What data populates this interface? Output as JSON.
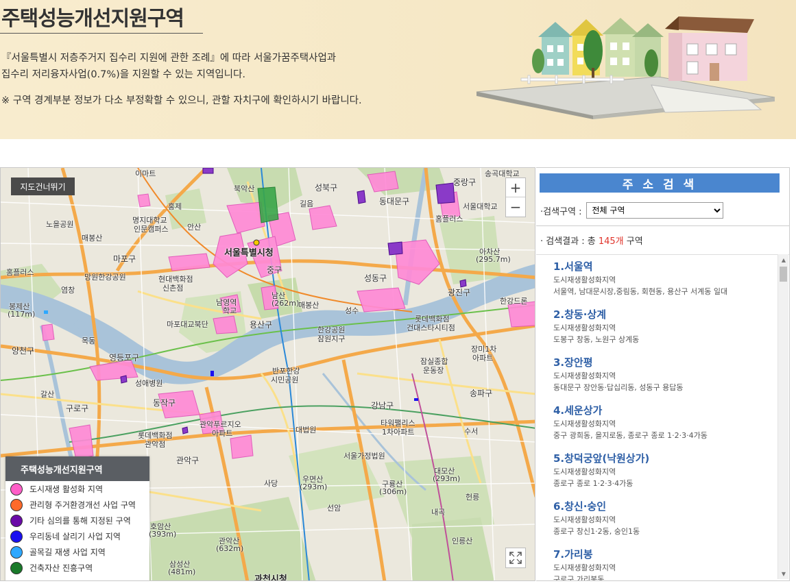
{
  "banner": {
    "title": "주택성능개선지원구역",
    "desc_line1": "『서울특별시 저층주거지 집수리 지원에 관한 조례』에 따라 서울가꿈주택사업과",
    "desc_line2": "집수리 저리융자사업(0.7%)을 지원할 수 있는 지역입니다.",
    "note": "※ 구역 경계부분 정보가 다소 부정확할 수 있으니, 관할 자치구에 확인하시기 바랍니다."
  },
  "map": {
    "skip_label": "지도건너뛰기",
    "zoom_in": "+",
    "zoom_out": "−",
    "labels": {
      "city_hall": "서울특별시청",
      "jung_gu": "중구",
      "yongsan_gu": "용산구",
      "seongdong_gu": "성동구",
      "gwangjin_gu": "광진구",
      "gangnam_gu": "강남구",
      "mapo_gu": "마포구",
      "yeongdeungpo_gu": "영등포구",
      "yangcheon_gu": "양천구",
      "guro_gu": "구로구",
      "dongjak_gu": "동작구",
      "gwanak_gu": "관악구",
      "songpa_gu": "송파구",
      "dongdaemun_gu": "동대문구",
      "seongbuk_gu": "성북구",
      "jungnang_gu": "중랑구",
      "namsan": "남산",
      "namsan_alt": "(262m)",
      "bongjesan": "봉제산",
      "bongjesan_alt": "(117m)",
      "achasan": "아차산",
      "achasan_alt": "(295.7m)",
      "umyeonsan": "우면산",
      "umyeonsan_alt": "(293m)",
      "gwanaksan": "관악산",
      "gwanaksan_alt": "(632m)",
      "samseongsan": "삼성산",
      "samseongsan_alt": "(481m)",
      "hoam": "호암산",
      "hoam_alt": "(393m)",
      "guryongsan": "구룡산",
      "guryongsan_alt": "(306m)",
      "daemosan": "대모산",
      "daemosan_alt": "(293m)",
      "hangang_park": "한강공원",
      "jamwon": "잠원지구",
      "banpo_park": "반포한강",
      "banpo_park2": "시민공원",
      "seoul_univ": "서울대학교",
      "seoul_court": "서울가정법원",
      "daebeopwon": "대법원",
      "tower_palace": "타워팰리스",
      "tower_palace2": "1차아파트",
      "hyundai_dept": "현대백화점",
      "hyundai_dept2": "신촌점",
      "lotte_dept": "롯데백화점",
      "lotte_dept2": "관악점",
      "seongae": "성애병원",
      "jamsil": "잠실종합",
      "jamsil2": "운동장",
      "home_plus": "홈플러스",
      "imart": "이마트",
      "homeplus_left": "홈플러스",
      "hongje": "홍제",
      "ansan": "안산",
      "maebongsan": "매봉산",
      "nowon": "노을공원",
      "mokdong": "목동",
      "gaesan": "갈산",
      "gwanakpurujio": "관악푸르지오",
      "gwanakpurujio2": "아파트",
      "gwacheon": "과천시청",
      "sadang": "사당",
      "seocho": "선암",
      "suseo": "수서",
      "naegok": "내곡",
      "inneungsan": "인릉산",
      "heonreung": "헌릉",
      "mapo_bridge": "마포대교북단",
      "sungsu": "성수",
      "lotte_world": "롯데백화점",
      "konkuk": "건대스타시티점",
      "jangmi": "장미1차",
      "jangmi2": "아파트",
      "myeongji": "명지대학교",
      "myeongji2": "인문캠퍼스",
      "seoul_univ_north": "서울대학교",
      "seoul_station": "남영역",
      "seoul_station2": "학교",
      "mangwon": "망원한강공원",
      "yeomchang": "염창",
      "songgok": "송곡대학교",
      "hansan": "한강드론",
      "gilbok": "길음",
      "bukak": "북악산",
      "maebongsan2": "매봉산",
      "dongdaemun_gate": "동대문구"
    }
  },
  "legend": {
    "title": "주택성능개선지원구역",
    "items": [
      {
        "label": "도시재생 활성화 지역",
        "color": "#ff5ec8"
      },
      {
        "label": "관리형 주거환경개선 사업 구역",
        "color": "#ff6a2a"
      },
      {
        "label": "기타 심의를 통해 지정된 구역",
        "color": "#6a0aa8"
      },
      {
        "label": "우리동네 살리기 사업 지역",
        "color": "#1a10f0"
      },
      {
        "label": "골목길 재생 사업 지역",
        "color": "#2ea8ff"
      },
      {
        "label": "건축자산 진흥구역",
        "color": "#1a7a2a"
      }
    ]
  },
  "panel": {
    "heading": "주 소 검 색",
    "search_label": "·검색구역 :",
    "select_value": "전체 구역",
    "result_prefix": "· 검색결과 : 총 ",
    "result_count": "145개",
    "result_suffix": " 구역",
    "results": [
      {
        "title": "1.서울역",
        "type": "도시재생활성화지역",
        "area": "서울역, 남대문시장,중림동, 회현동, 용산구 서계동 일대"
      },
      {
        "title": "2.창동·상계",
        "type": "도시재생활성화지역",
        "area": "도봉구 창동, 노원구 상계동"
      },
      {
        "title": "3.장안평",
        "type": "도시재생활성화지역",
        "area": "동대문구 장안동·답십리동, 성동구 용답동"
      },
      {
        "title": "4.세운상가",
        "type": "도시재생활성화지역",
        "area": "중구 광희동, 을지로동, 종로구 종로 1·2·3·4가동"
      },
      {
        "title": "5.창덕궁앞(낙원상가)",
        "type": "도시재생활성화지역",
        "area": "종로구 종로 1·2·3·4가동"
      },
      {
        "title": "6.창신·숭인",
        "type": "도시재생활성화지역",
        "area": "종로구 창신1·2동, 숭인1동"
      },
      {
        "title": "7.가리봉",
        "type": "도시재생활성화지역",
        "area": "구로구 가리봉동"
      }
    ]
  }
}
